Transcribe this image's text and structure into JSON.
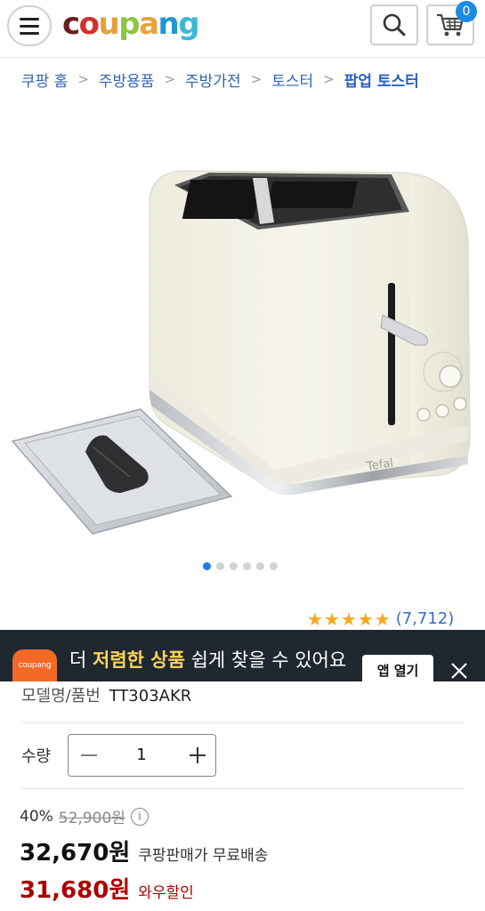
{
  "header": {
    "logo": [
      "c",
      "o",
      "u",
      "p",
      "a",
      "n",
      "g"
    ],
    "logo_colors": [
      "#6b1e1e",
      "#d3302d",
      "#e7a03c",
      "#8dc63f",
      "#e8a43a",
      "#1f98d6",
      "#3cb8d6"
    ],
    "cart_count": "0"
  },
  "breadcrumb": {
    "items": [
      "쿠팡 홈",
      "주방용품",
      "주방가전",
      "토스터"
    ],
    "current": "팝업 토스터"
  },
  "gallery": {
    "slides": 6,
    "active_index": 0
  },
  "rating": {
    "stars": 5,
    "count": "(7,712)",
    "star_color": "#f7a81b"
  },
  "app_banner": {
    "icon_text": "coupang",
    "text_pre": "더 ",
    "text_highlight": "저렴한 상품",
    "text_post": " 쉽게 찾을 수 있어요",
    "button_label": "앱 열기"
  },
  "model": {
    "label": "모델명/품번",
    "value": "TT303AKR"
  },
  "quantity": {
    "label": "수량",
    "value": "1"
  },
  "price": {
    "discount_rate": "40%",
    "original_price": "52,900원",
    "info_icon": "i",
    "sale_price": "32,670원",
    "shipping": "쿠팡판매가 무료배송",
    "wow_price": "31,680원",
    "wow_label": "와우할인",
    "wow_color": "#ae0000"
  }
}
